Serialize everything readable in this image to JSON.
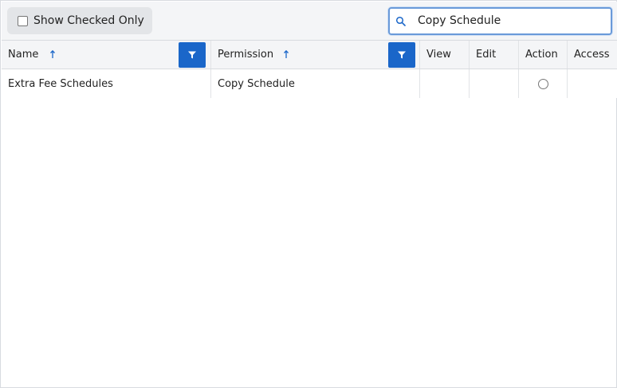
{
  "toolbar": {
    "show_checked_only_label": "Show Checked Only",
    "search_value": "Copy Schedule"
  },
  "table": {
    "columns": {
      "name": "Name",
      "permission": "Permission",
      "view": "View",
      "edit": "Edit",
      "action": "Action",
      "access": "Access"
    },
    "rows": [
      {
        "name": "Extra Fee Schedules",
        "permission": "Copy Schedule"
      }
    ]
  },
  "colors": {
    "accent": "#1a66c9",
    "header_bg": "#f4f5f7",
    "border": "#d8dbe0"
  }
}
